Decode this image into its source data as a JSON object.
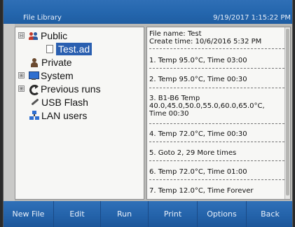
{
  "titlebar": {
    "title": "File Library",
    "datetime": "9/19/2017 1:15:22 PM"
  },
  "tree": {
    "public": {
      "expander": "⊟",
      "label": "Public"
    },
    "file": {
      "label": "Test.ad"
    },
    "private": {
      "label": "Private"
    },
    "system": {
      "expander": "⊞",
      "label": "System"
    },
    "previous": {
      "expander": "⊞",
      "label": "Previous runs"
    },
    "usb": {
      "label": "USB Flash"
    },
    "lan": {
      "label": "LAN users"
    }
  },
  "detail": {
    "file_name": "File name: Test",
    "create_time": "Create time: 10/6/2016 5:32 PM",
    "steps": [
      "1. Temp 95.0°C, Time 03:00",
      "2. Temp 95.0°C, Time 00:30",
      "3. B1-B6 Temp",
      "40.0,45.0,50.0,55.0,60.0,65.0°C,",
      "Time 00:30",
      "4. Temp 72.0°C, Time 00:30",
      "5. Goto 2, 29 More times",
      "6. Temp 72.0°C, Time 01:00",
      "7. Temp 12.0°C, Time Forever"
    ]
  },
  "buttons": {
    "new_file": "New File",
    "edit": "Edit",
    "run": "Run",
    "print": "Print",
    "options": "Options",
    "back": "Back"
  },
  "colors": {
    "bar_blue": "#2466ad",
    "selection_blue": "#2a5fb0",
    "panel_bg": "#f7f7f5"
  }
}
